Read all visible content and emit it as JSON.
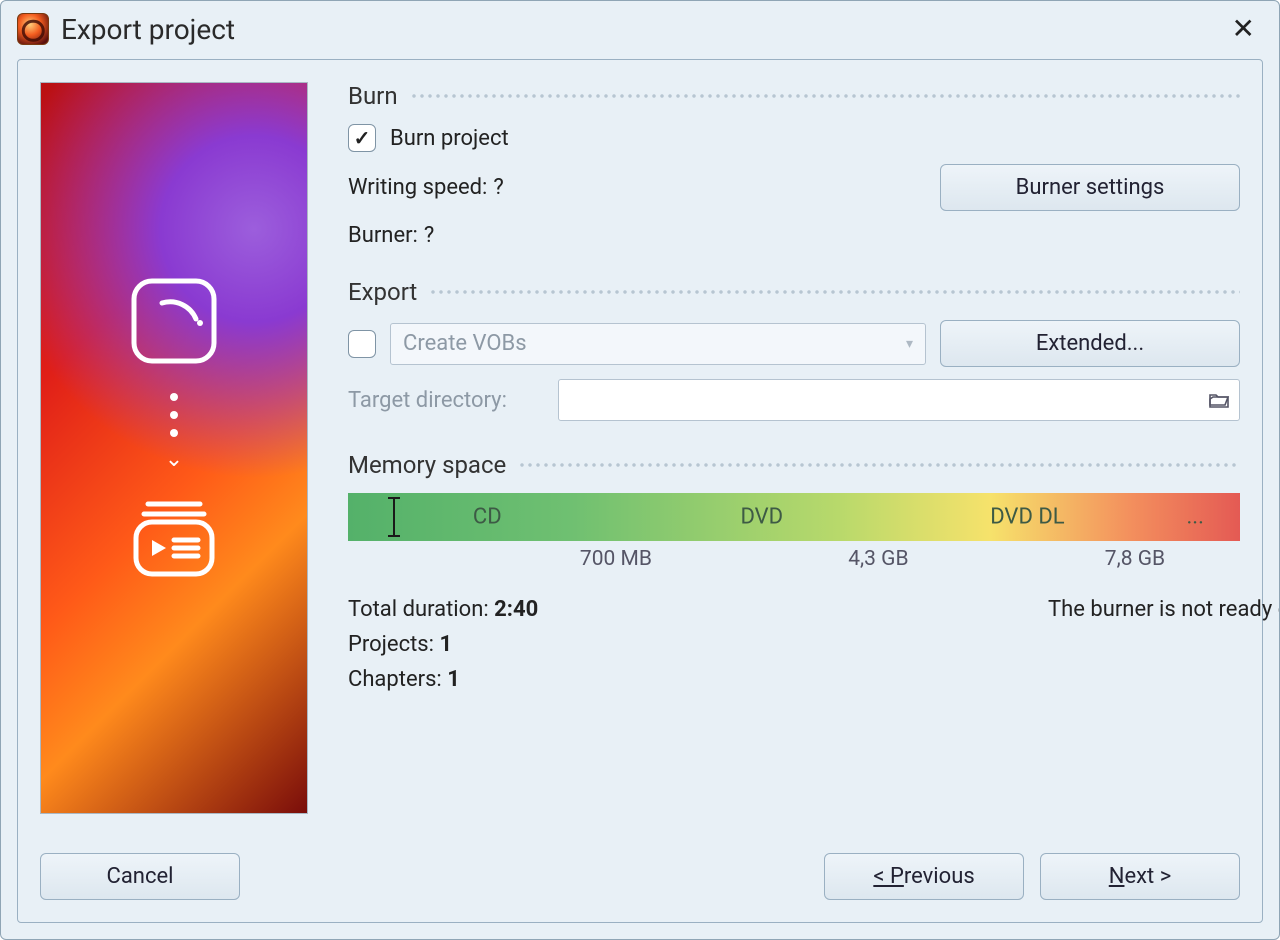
{
  "title": "Export project",
  "sections": {
    "burn": {
      "heading": "Burn",
      "burn_project_label": "Burn project",
      "burn_project_checked": true,
      "writing_speed_label": "Writing speed:",
      "writing_speed_value": "?",
      "burner_label": "Burner:",
      "burner_value": "?",
      "settings_button": "Burner settings"
    },
    "export": {
      "heading": "Export",
      "dropdown_value": "Create VOBs",
      "extended_button": "Extended...",
      "target_dir_label": "Target directory:",
      "target_dir_value": ""
    },
    "memory": {
      "heading": "Memory space",
      "segments": {
        "cd": "CD",
        "dvd": "DVD",
        "dvddl": "DVD DL",
        "more": "..."
      },
      "sizes": {
        "cd": "700 MB",
        "dvd": "4,3 GB",
        "dvddl": "7,8 GB"
      },
      "marker_percent": 5
    },
    "stats": {
      "total_duration_label": "Total duration:",
      "total_duration_value": "2:40",
      "projects_label": "Projects:",
      "projects_value": "1",
      "chapters_label": "Chapters:",
      "chapters_value": "1",
      "burner_message": "The burner is not ready or no writeable blank is inse"
    }
  },
  "footer": {
    "cancel": "Cancel",
    "previous": "<  Previous",
    "next": "Next  >"
  }
}
